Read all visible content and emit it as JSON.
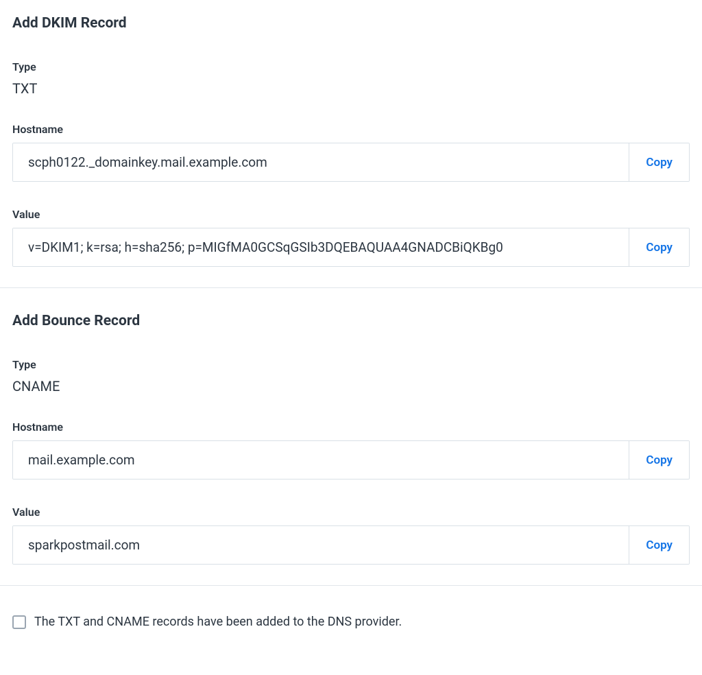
{
  "dkim": {
    "title": "Add DKIM Record",
    "type_label": "Type",
    "type_value": "TXT",
    "hostname_label": "Hostname",
    "hostname_value": "scph0122._domainkey.mail.example.com",
    "value_label": "Value",
    "value_value": "v=DKIM1; k=rsa; h=sha256; p=MIGfMA0GCSqGSIb3DQEBAQUAA4GNADCBiQKBg0",
    "copy_label": "Copy"
  },
  "bounce": {
    "title": "Add Bounce Record",
    "type_label": "Type",
    "type_value": "CNAME",
    "hostname_label": "Hostname",
    "hostname_value": "mail.example.com",
    "value_label": "Value",
    "value_value": "sparkpostmail.com",
    "copy_label": "Copy"
  },
  "confirm": {
    "label": "The TXT and CNAME records have been added to the DNS provider."
  }
}
